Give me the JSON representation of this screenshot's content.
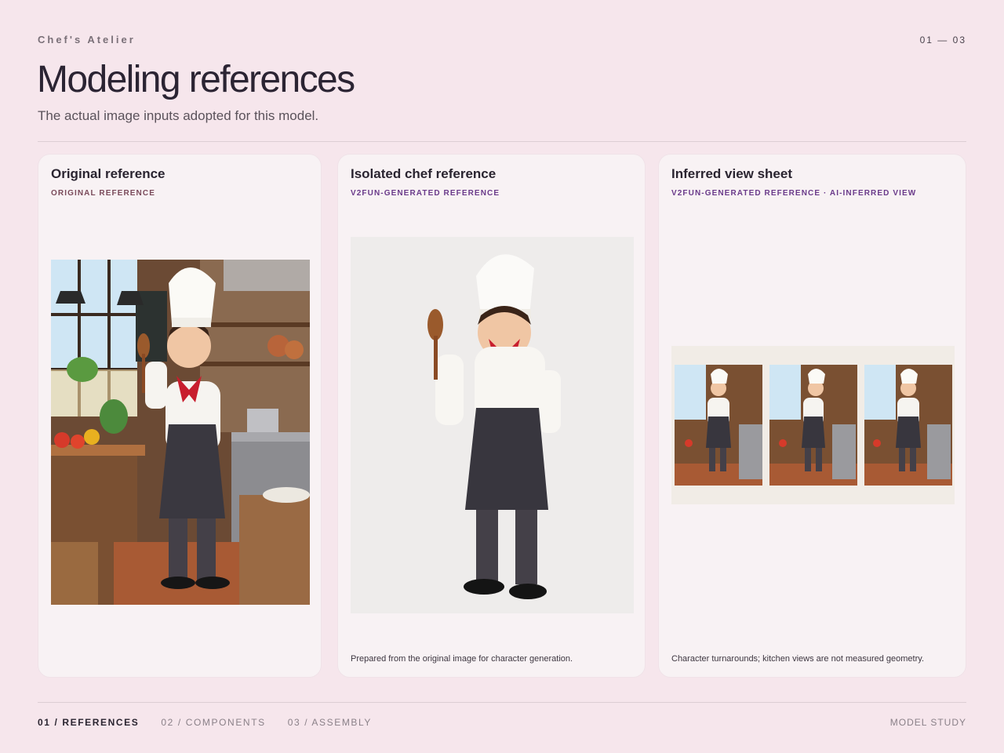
{
  "header": {
    "brand": "Chef's Atelier",
    "page_indicator": "01 — 03",
    "title": "Modeling references",
    "subtitle": "The actual image inputs adopted for this model."
  },
  "cards": [
    {
      "title": "Original reference",
      "tag": "ORIGINAL REFERENCE",
      "note": ""
    },
    {
      "title": "Isolated chef reference",
      "tag": "V2FUN-GENERATED REFERENCE",
      "note": "Prepared from the original image for character generation."
    },
    {
      "title": "Inferred view sheet",
      "tag": "V2FUN-GENERATED REFERENCE · AI-INFERRED VIEW",
      "note": "Character turnarounds; kitchen views are not measured geometry."
    }
  ],
  "nav": {
    "items": [
      {
        "label": "01 / REFERENCES"
      },
      {
        "label": "02 / COMPONENTS"
      },
      {
        "label": "03 / ASSEMBLY"
      }
    ],
    "right_label": "MODEL STUDY"
  },
  "colors": {
    "background": "#f6e6ec",
    "card": "#f8f2f4",
    "accent_purple": "#6a3a8a",
    "accent_mauve": "#7a4a5a"
  }
}
